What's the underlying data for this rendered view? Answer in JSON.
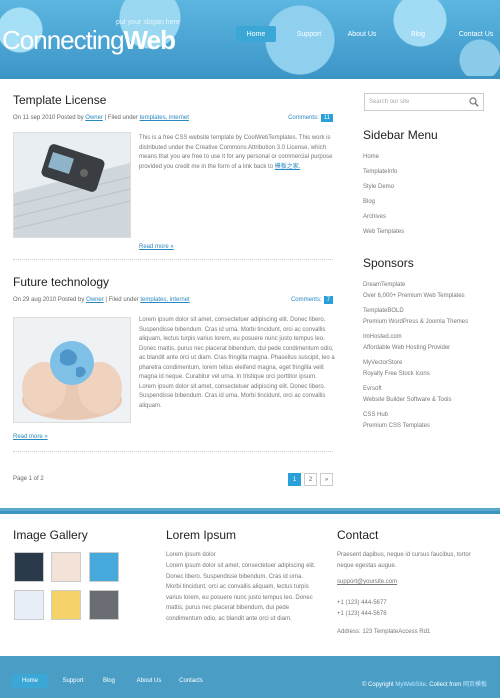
{
  "header": {
    "slogan": "put your slogan here",
    "logo_light": "Connecting",
    "logo_bold": "Web",
    "nav": [
      "Home",
      "Support",
      "About Us",
      "Blog",
      "Contact Us"
    ]
  },
  "posts": [
    {
      "title": "Template License",
      "meta_prefix": "On 11 sep 2010 Posted by",
      "author": "Owner",
      "filed": "Filed under",
      "tags": "templates, internet",
      "comments_label": "Comments:",
      "comments_count": "11",
      "text": "This is a free CSS website template by CoolWebTemplates. This work is distributed under the Creative Commons Attribution 3.0 License, which means that you are free to use it for any personal or commercial purpose provided you credit me in the form of a link back to",
      "text_link": "模板之家.",
      "read_more": "Read more »"
    },
    {
      "title": "Future technology",
      "meta_prefix": "On 29 aug 2010 Posted by",
      "author": "Owner",
      "filed": "Filed under",
      "tags": "templates, internet",
      "comments_label": "Comments:",
      "comments_count": "7",
      "text": "Lorem ipsum dolor sit amet, consectetuer adipiscing elit. Donec libero. Suspendisse bibendum. Cras id urna. Morbi tincidunt, orci ac convallis aliquam, lectus turpis varius lorem, eu posuere nunc justo tempus leo. Donec mattis, purus nec placerat bibendum, dui pede condimentum odio, ac blandit ante orci ut diam. Cras fringilla magna. Phasellus suscipit, leo a pharetra condimentum, lorem tellus eleifend magna, eget fringilla velit magna id neque. Curabitur vel urna. In tristique orci porttitor ipsum. Lorem ipsum dolor sit amet, consectetuer adipiscing elit. Donec libero. Suspendisse bibendum. Cras id urna. Morbi tincidunt, orci ac convallis aliquam.",
      "read_more": "Read more »"
    }
  ],
  "pager": {
    "label": "Page 1 of 2",
    "pages": [
      "1",
      "2",
      "»"
    ]
  },
  "sidebar": {
    "search_placeholder": "Search our site",
    "menu_title": "Sidebar Menu",
    "menu": [
      "Home",
      "TemplateInfo",
      "Style Demo",
      "Blog",
      "Archives",
      "Web Templates"
    ],
    "sponsors_title": "Sponsors",
    "sponsors": [
      {
        "name": "DreamTemplate",
        "desc": "Over 6,000+ Premium Web Templates"
      },
      {
        "name": "TemplateBOLD",
        "desc": "Premium WordPress & Joomla Themes"
      },
      {
        "name": "ImHosted.com",
        "desc": "Affordable Web Hosting Provider"
      },
      {
        "name": "MyVectorStore",
        "desc": "Royalty Free Stock Icons"
      },
      {
        "name": "Evrsoft",
        "desc": "Website Builder Software & Tools"
      },
      {
        "name": "CSS Hub",
        "desc": "Premium CSS Templates"
      }
    ]
  },
  "bottom": {
    "gallery_title": "Image Gallery",
    "lorem_title": "Lorem Ipsum",
    "lorem_sub": "Lorem ipsum dolor",
    "lorem_text": "Lorem ipsum dolor sit amet, consectetuer adipiscing elit. Donec libero. Suspendisse bibendum. Cras id urna. Morbi tincidunt, orci ac convallis aliquam, lectus turpis varius lorem, eu posuere nunc justo tempus leo. Donec mattis, purus nec placerat bibendum, dui pede condimentum odio, ac blandit ante orci ut diam.",
    "contact_title": "Contact",
    "contact_text": "Praesent dapibus, neque id cursus faucibus, tortor neque egestas augue.",
    "email": "support@yoursite.com",
    "phone1": "+1 (123) 444-5677",
    "phone2": "+1 (123) 444-5678",
    "address": "Address: 123 TemplateAccess Rd1"
  },
  "footer": {
    "nav": [
      "Home",
      "Support",
      "Blog",
      "About Us",
      "Contacts"
    ],
    "copyright": "© Copyright",
    "site_link": "MyWebSite",
    "collect_label": ". Collect from",
    "collect_link": "网页模板"
  },
  "colors": {
    "accent": "#2aa0d8",
    "header_blue": "#3d96c8",
    "footer_blue": "#4a9ec6"
  }
}
